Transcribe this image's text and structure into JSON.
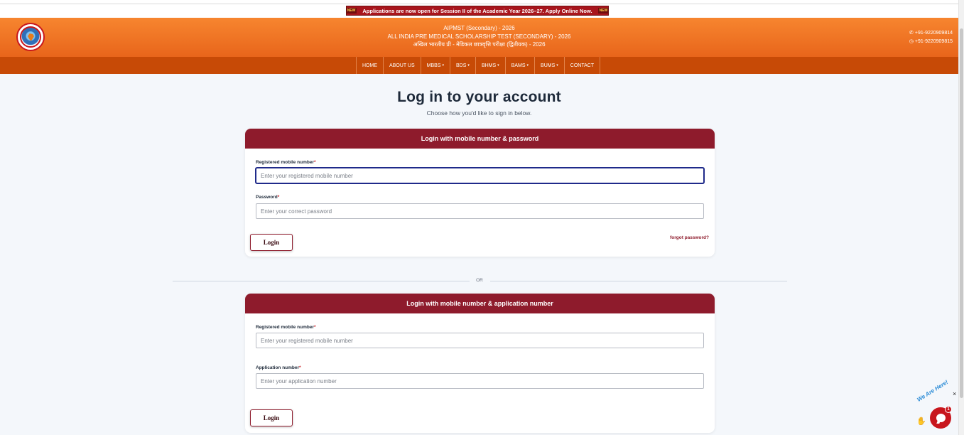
{
  "announcement": {
    "badge_left": "NEW",
    "text": "Applications are now open for Session II of the Academic Year 2026–27. Apply Online Now.",
    "badge_right": "NEW"
  },
  "header": {
    "line1": "AIPMST (Secondary) - 2026",
    "line2": "ALL INDIA PRE MEDICAL SCHOLARSHIP TEST (SECONDARY) - 2026",
    "line3": "अखिल भारतीय प्री - मेडिकल छात्रवृत्ति परीक्षा (द्वितीयक) - 2026",
    "phone": "+91-9220909814",
    "whatsapp": "+91-9220909815",
    "phone_icon": "phone-icon",
    "whatsapp_icon": "whatsapp-icon"
  },
  "nav": {
    "items": [
      {
        "label": "HOME",
        "dropdown": false
      },
      {
        "label": "ABOUT US",
        "dropdown": false
      },
      {
        "label": "MBBS",
        "dropdown": true
      },
      {
        "label": "BDS",
        "dropdown": true
      },
      {
        "label": "BHMS",
        "dropdown": true
      },
      {
        "label": "BAMS",
        "dropdown": true
      },
      {
        "label": "BUMS",
        "dropdown": true
      },
      {
        "label": "CONTACT",
        "dropdown": false
      }
    ],
    "caret": "▾"
  },
  "page": {
    "title": "Log in to your account",
    "subtitle": "Choose how you'd like to sign in below.",
    "or_text": "OR"
  },
  "card_password": {
    "heading": "Login with mobile number & password",
    "mobile_label": "Registered mobile number",
    "mobile_placeholder": "Enter your registered mobile number",
    "mobile_value": "",
    "password_label": "Password",
    "password_placeholder": "Enter your correct password",
    "password_value": "",
    "required_mark": "*",
    "login_label": "Login",
    "forgot_label": "forgot password?"
  },
  "card_application": {
    "heading": "Login with mobile number & application number",
    "mobile_label": "Registered mobile number",
    "mobile_placeholder": "Enter your registered mobile number",
    "mobile_value": "",
    "application_label": "Application number",
    "application_placeholder": "Enter your application number",
    "application_value": "",
    "required_mark": "*",
    "login_label": "Login"
  },
  "chat_widget": {
    "ribbon_text": "We Are Here!",
    "badge_count": "1",
    "close_symbol": "×"
  },
  "colors": {
    "header_orange": "#f07a25",
    "nav_orange": "#c74a06",
    "card_maroon": "#8e1b2c",
    "ticker_red": "#a8151c"
  }
}
